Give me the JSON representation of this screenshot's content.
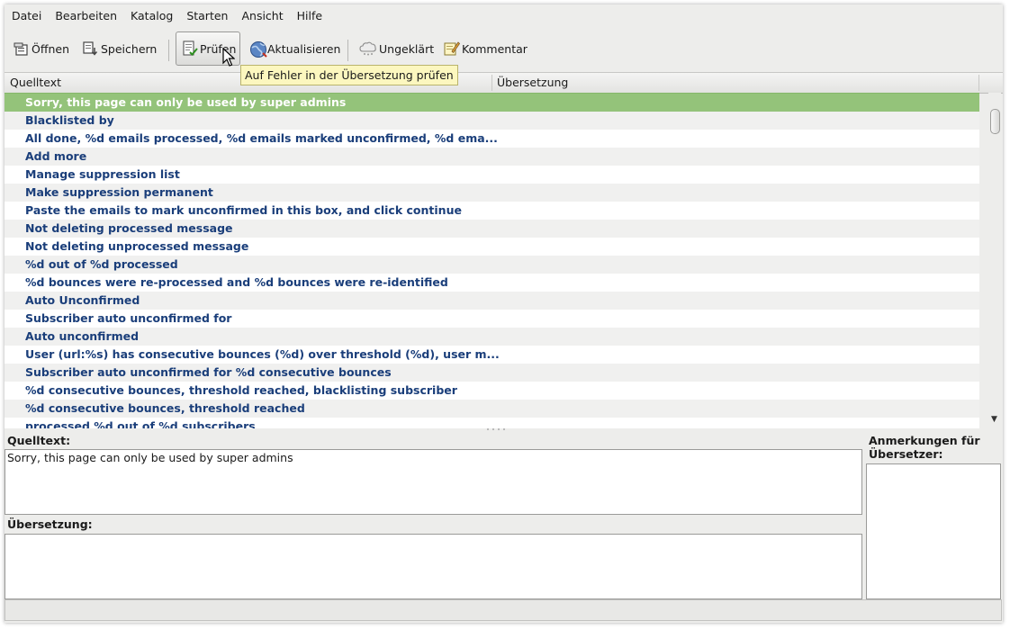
{
  "menu": [
    "Datei",
    "Bearbeiten",
    "Katalog",
    "Starten",
    "Ansicht",
    "Hilfe"
  ],
  "toolbar": {
    "open": "Öffnen",
    "save": "Speichern",
    "validate": "Prüfen",
    "update": "Aktualisieren",
    "fuzzy": "Ungeklärt",
    "comment": "Kommentar"
  },
  "tooltip": "Auf Fehler in der Übersetzung prüfen",
  "columns": {
    "source": "Quelltext",
    "translation": "Übersetzung"
  },
  "entries": [
    "Sorry, this page can only be used by super admins",
    "Blacklisted by",
    "All done, %d emails processed, %d emails marked unconfirmed, %d ema...",
    "Add more",
    "Manage suppression list",
    "Make suppression permanent",
    "Paste the emails to mark unconfirmed in this box, and click continue",
    "Not deleting processed message",
    "Not deleting unprocessed message",
    "%d out of %d processed",
    "%d bounces were re-processed and %d bounces were re-identified",
    "Auto Unconfirmed",
    "Subscriber auto unconfirmed for",
    "Auto unconfirmed",
    "User (url:%s) has consecutive bounces (%d) over threshold (%d), user m...",
    "Subscriber auto unconfirmed for %d consecutive bounces",
    "%d consecutive bounces, threshold reached, blacklisting subscriber",
    "%d consecutive bounces, threshold reached",
    "processed %d out of %d subscribers"
  ],
  "selected_index": 0,
  "editor": {
    "source_label": "Quelltext:",
    "source_text": "Sorry, this page can only be used by super admins",
    "translation_label": "Übersetzung:",
    "translation_text": "",
    "notes_label": "Anmerkungen für Übersetzer:",
    "notes_text": ""
  },
  "colors": {
    "selection": "#94c37a",
    "entry_text": "#1a3e7a",
    "tooltip_bg": "#fcf7bf"
  },
  "icons": [
    "open-folder-icon",
    "save-icon",
    "validate-check-icon",
    "update-globe-icon",
    "fuzzy-cloud-icon",
    "comment-pencil-icon"
  ]
}
